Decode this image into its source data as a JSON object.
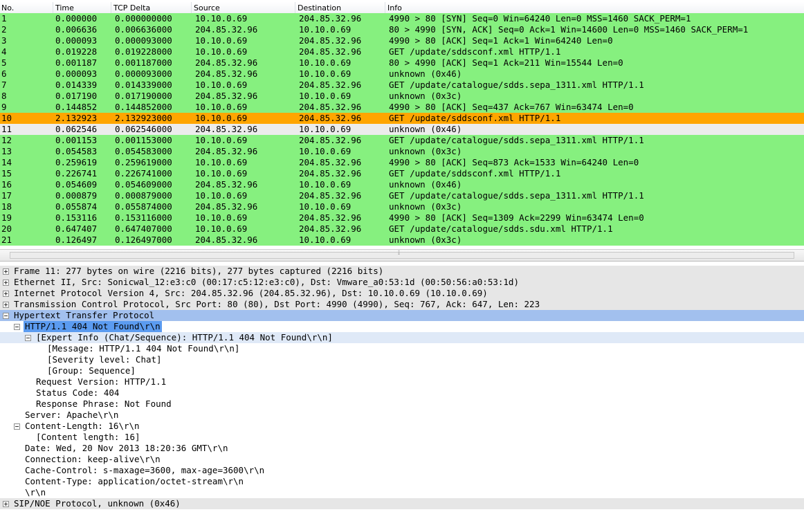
{
  "columns": [
    "No.",
    "Time",
    "TCP Delta",
    "Source",
    "Destination",
    "Info"
  ],
  "colors": {
    "green": "#86f07f",
    "orange": "#ffa500",
    "gray": "#ececec",
    "selection_blue": "#a2c0ee"
  },
  "packets": [
    {
      "no": "1",
      "time": "0.000000",
      "delta": "0.000000000",
      "src": "10.10.0.69",
      "dst": "204.85.32.96",
      "info": "4990 > 80 [SYN] Seq=0 Win=64240 Len=0 MSS=1460 SACK_PERM=1",
      "style": "green"
    },
    {
      "no": "2",
      "time": "0.006636",
      "delta": "0.006636000",
      "src": "204.85.32.96",
      "dst": "10.10.0.69",
      "info": "80 > 4990 [SYN, ACK] Seq=0 Ack=1 Win=14600 Len=0 MSS=1460 SACK_PERM=1",
      "style": "green"
    },
    {
      "no": "3",
      "time": "0.000093",
      "delta": "0.000093000",
      "src": "10.10.0.69",
      "dst": "204.85.32.96",
      "info": "4990 > 80 [ACK] Seq=1 Ack=1 Win=64240 Len=0",
      "style": "green"
    },
    {
      "no": "4",
      "time": "0.019228",
      "delta": "0.019228000",
      "src": "10.10.0.69",
      "dst": "204.85.32.96",
      "info": "GET /update/sddsconf.xml HTTP/1.1",
      "style": "green"
    },
    {
      "no": "5",
      "time": "0.001187",
      "delta": "0.001187000",
      "src": "204.85.32.96",
      "dst": "10.10.0.69",
      "info": "80 > 4990 [ACK] Seq=1 Ack=211 Win=15544 Len=0",
      "style": "green"
    },
    {
      "no": "6",
      "time": "0.000093",
      "delta": "0.000093000",
      "src": "204.85.32.96",
      "dst": "10.10.0.69",
      "info": "unknown (0x46)",
      "style": "green"
    },
    {
      "no": "7",
      "time": "0.014339",
      "delta": "0.014339000",
      "src": "10.10.0.69",
      "dst": "204.85.32.96",
      "info": "GET /update/catalogue/sdds.sepa_1311.xml HTTP/1.1",
      "style": "green"
    },
    {
      "no": "8",
      "time": "0.017190",
      "delta": "0.017190000",
      "src": "204.85.32.96",
      "dst": "10.10.0.69",
      "info": "unknown (0x3c)",
      "style": "green"
    },
    {
      "no": "9",
      "time": "0.144852",
      "delta": "0.144852000",
      "src": "10.10.0.69",
      "dst": "204.85.32.96",
      "info": "4990 > 80 [ACK] Seq=437 Ack=767 Win=63474 Len=0",
      "style": "green"
    },
    {
      "no": "10",
      "time": "2.132923",
      "delta": "2.132923000",
      "src": "10.10.0.69",
      "dst": "204.85.32.96",
      "info": "GET /update/sddsconf.xml HTTP/1.1",
      "style": "orange"
    },
    {
      "no": "11",
      "time": "0.062546",
      "delta": "0.062546000",
      "src": "204.85.32.96",
      "dst": "10.10.0.69",
      "info": "unknown (0x46)",
      "style": "gray"
    },
    {
      "no": "12",
      "time": "0.001153",
      "delta": "0.001153000",
      "src": "10.10.0.69",
      "dst": "204.85.32.96",
      "info": "GET /update/catalogue/sdds.sepa_1311.xml HTTP/1.1",
      "style": "green"
    },
    {
      "no": "13",
      "time": "0.054583",
      "delta": "0.054583000",
      "src": "204.85.32.96",
      "dst": "10.10.0.69",
      "info": "unknown (0x3c)",
      "style": "green"
    },
    {
      "no": "14",
      "time": "0.259619",
      "delta": "0.259619000",
      "src": "10.10.0.69",
      "dst": "204.85.32.96",
      "info": "4990 > 80 [ACK] Seq=873 Ack=1533 Win=64240 Len=0",
      "style": "green"
    },
    {
      "no": "15",
      "time": "0.226741",
      "delta": "0.226741000",
      "src": "10.10.0.69",
      "dst": "204.85.32.96",
      "info": "GET /update/sddsconf.xml HTTP/1.1",
      "style": "green"
    },
    {
      "no": "16",
      "time": "0.054609",
      "delta": "0.054609000",
      "src": "204.85.32.96",
      "dst": "10.10.0.69",
      "info": "unknown (0x46)",
      "style": "green"
    },
    {
      "no": "17",
      "time": "0.000879",
      "delta": "0.000879000",
      "src": "10.10.0.69",
      "dst": "204.85.32.96",
      "info": "GET /update/catalogue/sdds.sepa_1311.xml HTTP/1.1",
      "style": "green"
    },
    {
      "no": "18",
      "time": "0.055874",
      "delta": "0.055874000",
      "src": "204.85.32.96",
      "dst": "10.10.0.69",
      "info": "unknown (0x3c)",
      "style": "green"
    },
    {
      "no": "19",
      "time": "0.153116",
      "delta": "0.153116000",
      "src": "10.10.0.69",
      "dst": "204.85.32.96",
      "info": "4990 > 80 [ACK] Seq=1309 Ack=2299 Win=63474 Len=0",
      "style": "green"
    },
    {
      "no": "20",
      "time": "0.647407",
      "delta": "0.647407000",
      "src": "10.10.0.69",
      "dst": "204.85.32.96",
      "info": "GET /update/catalogue/sdds.sdu.xml HTTP/1.1",
      "style": "green"
    },
    {
      "no": "21",
      "time": "0.126497",
      "delta": "0.126497000",
      "src": "204.85.32.96",
      "dst": "10.10.0.69",
      "info": "unknown (0x3c)",
      "style": "green"
    }
  ],
  "splitter_grip": "⦙⦙",
  "details": [
    {
      "level": 0,
      "toggle": "plus",
      "text": "Frame 11: 277 bytes on wire (2216 bits), 277 bytes captured (2216 bits)",
      "style": "shaded"
    },
    {
      "level": 0,
      "toggle": "plus",
      "text": "Ethernet II, Src: Sonicwal_12:e3:c0 (00:17:c5:12:e3:c0), Dst: Vmware_a0:53:1d (00:50:56:a0:53:1d)",
      "style": "shaded"
    },
    {
      "level": 0,
      "toggle": "plus",
      "text": "Internet Protocol Version 4, Src: 204.85.32.96 (204.85.32.96), Dst: 10.10.0.69 (10.10.0.69)",
      "style": "shaded"
    },
    {
      "level": 0,
      "toggle": "plus",
      "text": "Transmission Control Protocol, Src Port: 80 (80), Dst Port: 4990 (4990), Seq: 767, Ack: 647, Len: 223",
      "style": "shaded"
    },
    {
      "level": 0,
      "toggle": "minus",
      "text": "Hypertext Transfer Protocol",
      "style": "selected"
    },
    {
      "level": 1,
      "toggle": "minus",
      "text": "HTTP/1.1 404 Not Found\\r\\n",
      "style": "inner-sel"
    },
    {
      "level": 2,
      "toggle": "minus",
      "text": "[Expert Info (Chat/Sequence): HTTP/1.1 404 Not Found\\r\\n]",
      "style": "hlight"
    },
    {
      "level": 3,
      "toggle": "",
      "text": "[Message: HTTP/1.1 404 Not Found\\r\\n]",
      "style": ""
    },
    {
      "level": 3,
      "toggle": "",
      "text": "[Severity level: Chat]",
      "style": ""
    },
    {
      "level": 3,
      "toggle": "",
      "text": "[Group: Sequence]",
      "style": ""
    },
    {
      "level": 2,
      "toggle": "",
      "text": "Request Version: HTTP/1.1",
      "style": ""
    },
    {
      "level": 2,
      "toggle": "",
      "text": "Status Code: 404",
      "style": ""
    },
    {
      "level": 2,
      "toggle": "",
      "text": "Response Phrase: Not Found",
      "style": ""
    },
    {
      "level": 1,
      "toggle": "",
      "text": "Server: Apache\\r\\n",
      "style": ""
    },
    {
      "level": 1,
      "toggle": "minus",
      "text": "Content-Length: 16\\r\\n",
      "style": ""
    },
    {
      "level": 2,
      "toggle": "",
      "text": "[Content length: 16]",
      "style": ""
    },
    {
      "level": 1,
      "toggle": "",
      "text": "Date: Wed, 20 Nov 2013 18:20:36 GMT\\r\\n",
      "style": ""
    },
    {
      "level": 1,
      "toggle": "",
      "text": "Connection: keep-alive\\r\\n",
      "style": ""
    },
    {
      "level": 1,
      "toggle": "",
      "text": "Cache-Control: s-maxage=3600, max-age=3600\\r\\n",
      "style": ""
    },
    {
      "level": 1,
      "toggle": "",
      "text": "Content-Type: application/octet-stream\\r\\n",
      "style": ""
    },
    {
      "level": 1,
      "toggle": "",
      "text": "\\r\\n",
      "style": ""
    },
    {
      "level": 0,
      "toggle": "plus",
      "text": "SIP/NOE Protocol, unknown (0x46)",
      "style": "shaded"
    }
  ]
}
